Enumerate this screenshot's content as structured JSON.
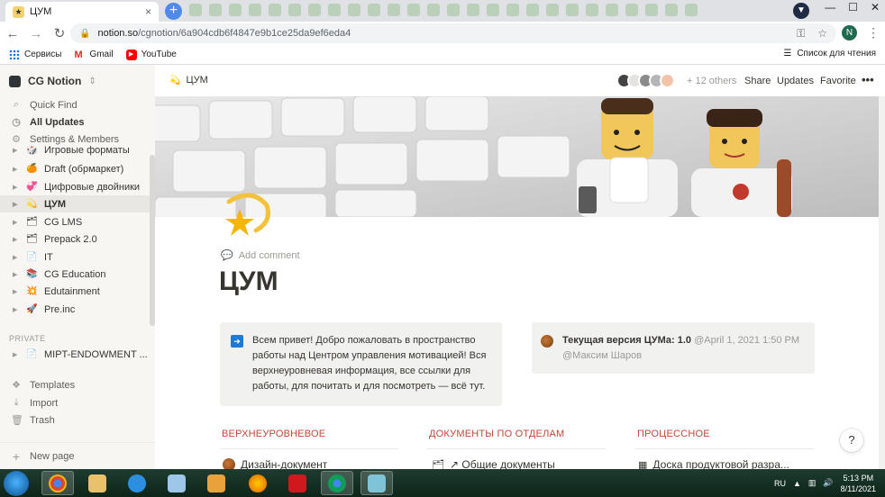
{
  "browser": {
    "tab_title": "ЦУМ",
    "url_host": "notion.so",
    "url_path": "/cgnotion/6a904cdb6f4847e9b1ce25da9ef6eda4",
    "bookmarks": [
      "Сервисы",
      "Gmail",
      "YouTube"
    ],
    "reading_list": "Список для чтения",
    "profile_initial": "N",
    "new_tab": "+",
    "close_tab": "×",
    "minimize": "—",
    "maximize": "☐",
    "close_window": "✕"
  },
  "sidebar": {
    "workspace": "CG Notion",
    "top_items": [
      {
        "label": "Quick Find",
        "icon": "search-icon"
      },
      {
        "label": "All Updates",
        "icon": "clock-icon"
      },
      {
        "label": "Settings & Members",
        "icon": "gear-icon"
      }
    ],
    "pages": [
      {
        "label": "Игровые форматы",
        "icon": "🎲"
      },
      {
        "label": "Draft (обрмаркет)",
        "icon": "🍊"
      },
      {
        "label": "Цифровые двойники",
        "icon": "💞"
      },
      {
        "label": "ЦУМ",
        "icon": "💫"
      },
      {
        "label": "CG LMS",
        "icon": "🗂"
      },
      {
        "label": "Prepack 2.0",
        "icon": "🗂"
      },
      {
        "label": "IT",
        "icon": "📄"
      },
      {
        "label": "CG Education",
        "icon": "📚"
      },
      {
        "label": "Edutainment",
        "icon": "💥"
      },
      {
        "label": "Pre.inc",
        "icon": "🚀"
      }
    ],
    "private_label": "PRIVATE",
    "private_pages": [
      {
        "label": "MIPT-ENDOWMENT ...",
        "icon": "📄"
      }
    ],
    "bottom_items": [
      {
        "label": "Templates",
        "icon": "templates-icon"
      },
      {
        "label": "Import",
        "icon": "import-icon"
      },
      {
        "label": "Trash",
        "icon": "trash-icon"
      }
    ],
    "new_page": "New page"
  },
  "topbar": {
    "breadcrumb": "ЦУМ",
    "others": "+ 12 others",
    "share": "Share",
    "updates": "Updates",
    "favorite": "Favorite",
    "more": "•••"
  },
  "page": {
    "add_comment": "Add comment",
    "title": "ЦУМ",
    "callout_left": "Всем привет! Добро пожаловать в пространство работы над Центром управления мотивацией! Вся верхнеуровневая информация, все ссылки для работы, для почитать и для посмотреть — всё тут.",
    "callout_right_bold": "Текущая версия ЦУМа: 1.0",
    "callout_right_mention": "@April 1, 2021 1:50 PM",
    "callout_right_user": "@Максим Шаров",
    "sections": [
      {
        "heading": "ВЕРХНЕУРОВНЕВОЕ",
        "first_item": "Дизайн-документ"
      },
      {
        "heading": "ДОКУМЕНТЫ ПО ОТДЕЛАМ",
        "first_item": "↗ Общие документы"
      },
      {
        "heading": "ПРОЦЕССНОЕ",
        "first_item": "Доска продуктовой разра..."
      }
    ],
    "help": "?"
  },
  "taskbar": {
    "lang": "RU",
    "time": "5:13 PM",
    "date": "8/11/2021"
  }
}
